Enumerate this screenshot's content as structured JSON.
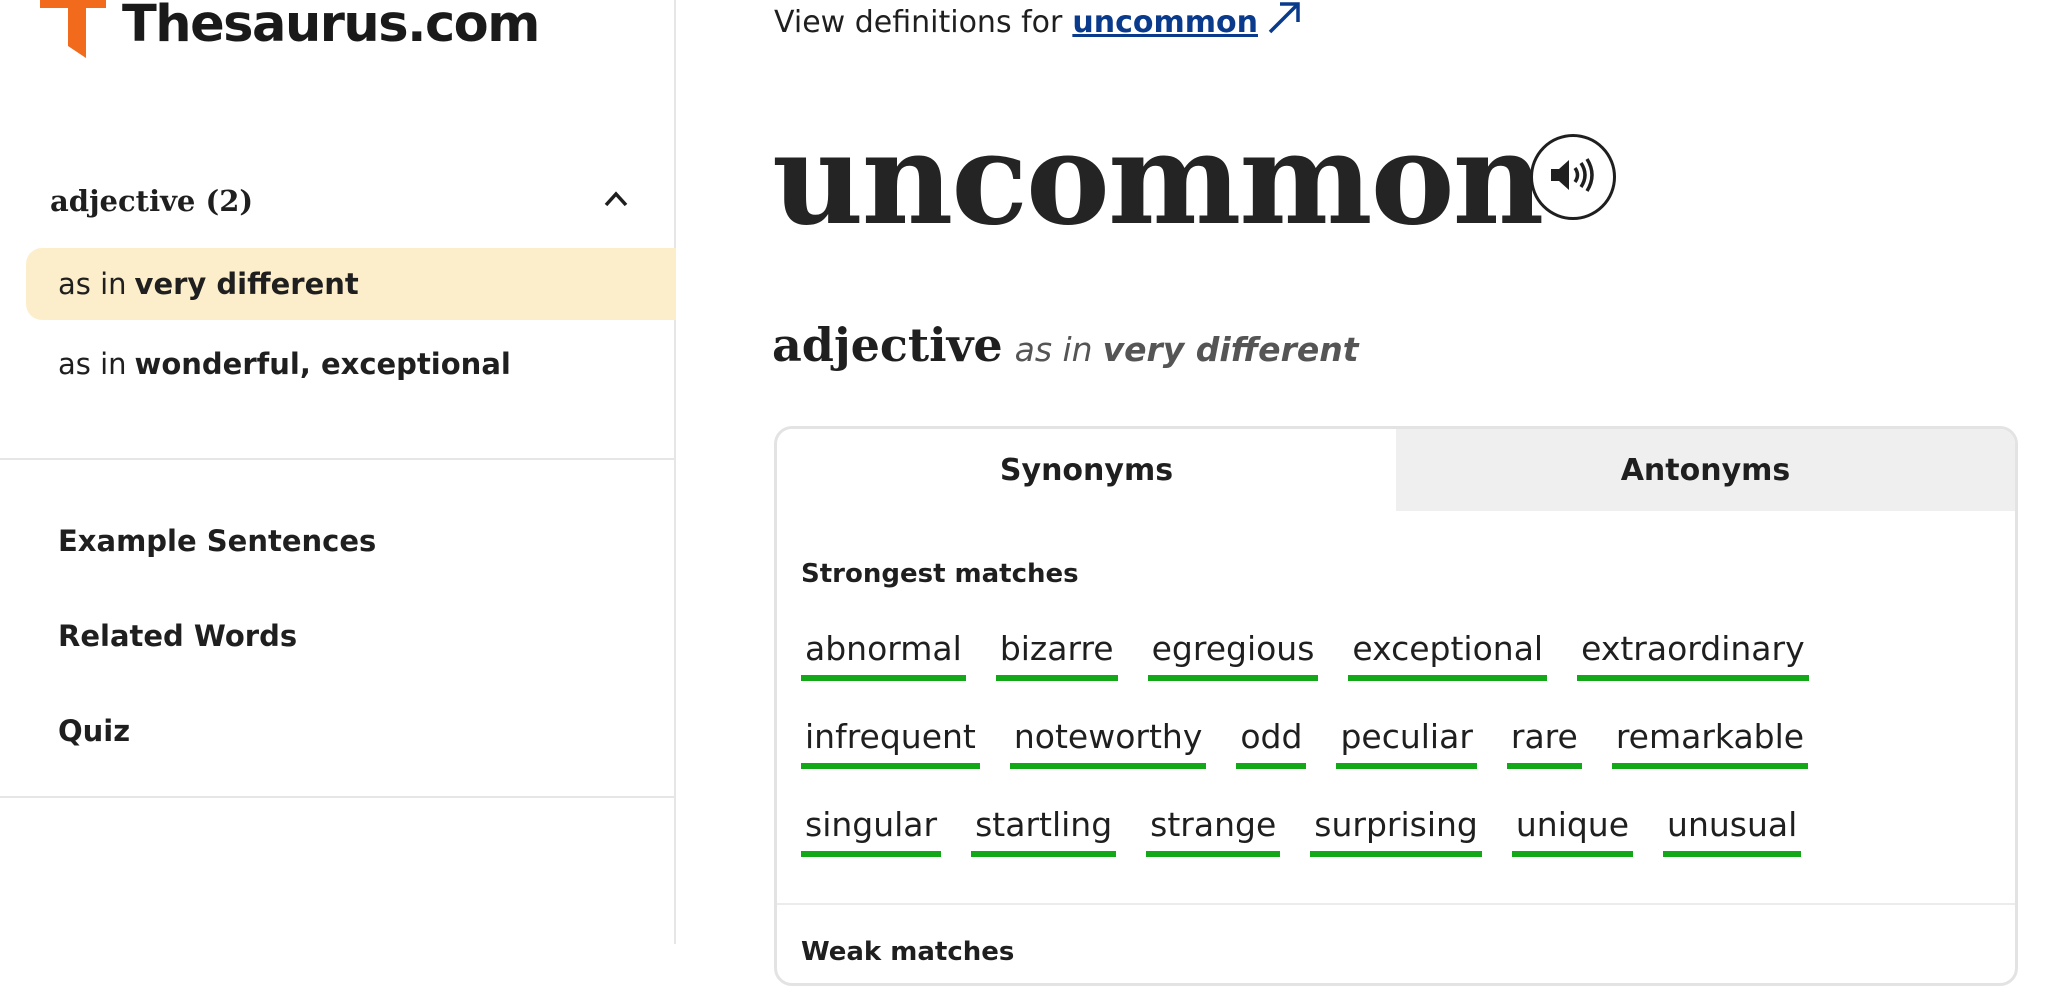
{
  "colors": {
    "accent_orange": "#f26a1b",
    "highlight": "#fdeecb",
    "link_blue": "#0a3a8c",
    "underline_green": "#12a818"
  },
  "brand": {
    "name": "Thesaurus.com",
    "logo_icon": "thesaurus-t-logo"
  },
  "sidebar": {
    "pos_title": "adjective (2)",
    "senses": [
      {
        "prefix": "as in",
        "label": "very different",
        "active": true
      },
      {
        "prefix": "as in",
        "label": "wonderful, exceptional",
        "active": false
      }
    ],
    "links": [
      "Example Sentences",
      "Related Words",
      "Quiz"
    ]
  },
  "main": {
    "view_definitions_prefix": "View definitions for",
    "view_definitions_link": "uncommon",
    "headword": "uncommon",
    "sense_pos": "adjective",
    "sense_asin": "as in",
    "sense_def": "very different",
    "tabs": [
      "Synonyms",
      "Antonyms"
    ],
    "strongest_title": "Strongest matches",
    "synonym_rows": [
      [
        "abnormal",
        "bizarre",
        "egregious",
        "exceptional",
        "extraordinary"
      ],
      [
        "infrequent",
        "noteworthy",
        "odd",
        "peculiar",
        "rare",
        "remarkable"
      ],
      [
        "singular",
        "startling",
        "strange",
        "surprising",
        "unique",
        "unusual"
      ]
    ],
    "weak_title": "Weak matches"
  }
}
